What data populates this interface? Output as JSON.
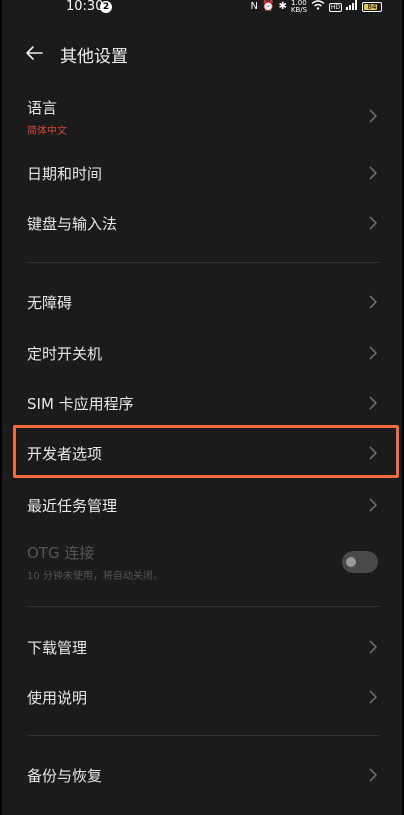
{
  "status_bar": {
    "time": "10:30",
    "notification_count": "2",
    "icons": [
      "nfc-icon",
      "alarm-icon",
      "bluetooth-icon",
      "net-speed-icon",
      "wifi-icon",
      "hd-icon",
      "signal-icon",
      "battery-icon"
    ],
    "net_speed": "1.00 KB/S",
    "hd_label": "HD",
    "battery_level": "84",
    "battery_color": "#e0c55a"
  },
  "header": {
    "title": "其他设置"
  },
  "items": [
    {
      "label": "语言",
      "sub": "简体中文",
      "sub_color": "#d6453a"
    },
    {
      "label": "日期和时间"
    },
    {
      "label": "键盘与输入法"
    },
    {
      "label": "无障碍"
    },
    {
      "label": "定时开关机"
    },
    {
      "label": "SIM 卡应用程序"
    },
    {
      "label": "开发者选项"
    },
    {
      "label": "最近任务管理"
    },
    {
      "label": "OTG 连接",
      "sub": "10 分钟未使用，将自动关闭。",
      "disabled": true,
      "toggle_on": false
    },
    {
      "label": "下载管理"
    },
    {
      "label": "使用说明"
    },
    {
      "label": "备份与恢复"
    }
  ],
  "colors": {
    "background": "#1b1b1b",
    "highlight": "#f26a3d",
    "text": "#e8e8e8",
    "disabled_text": "#555555"
  }
}
